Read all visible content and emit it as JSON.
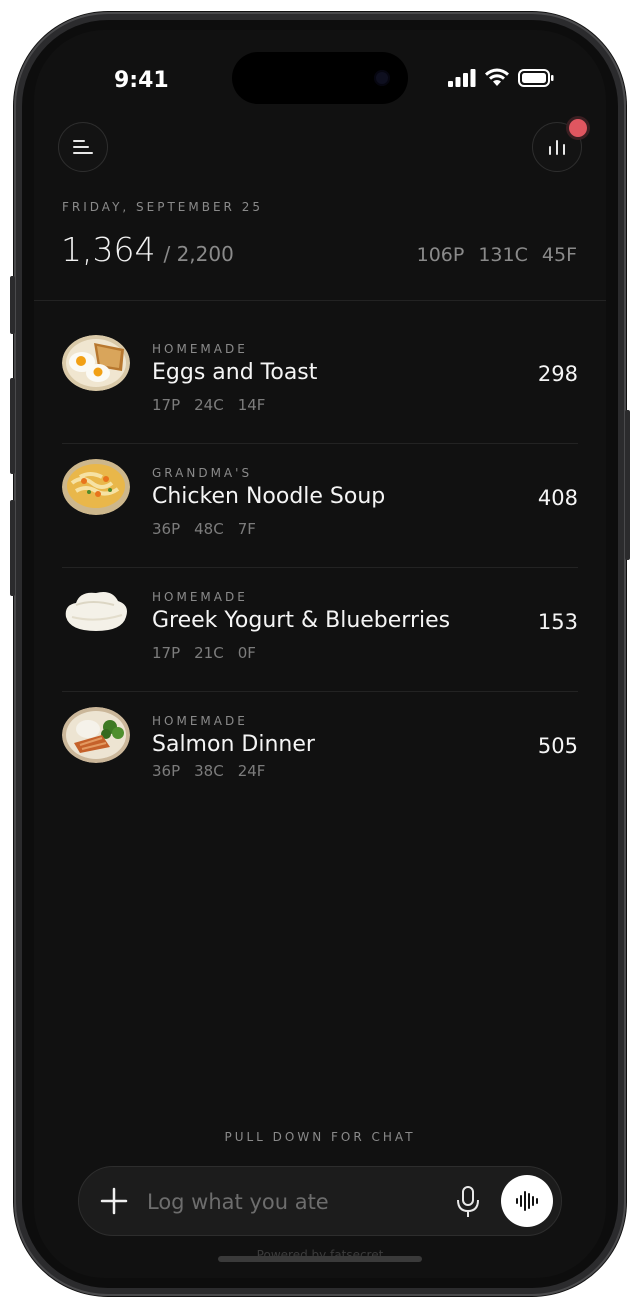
{
  "status_bar": {
    "time": "9:41"
  },
  "header": {
    "menu_icon": "menu-lines-icon",
    "stats_icon": "bar-chart-icon",
    "notification_color": "#e05660"
  },
  "summary": {
    "date": "FRIDAY, SEPTEMBER 25",
    "calories_consumed": "1,364",
    "calories_goal": "/ 2,200",
    "protein": "106P",
    "carbs": "131C",
    "fat": "45F"
  },
  "meals": [
    {
      "source": "HOMEMADE",
      "name": "Eggs and Toast",
      "calories": "298",
      "protein": "17P",
      "carbs": "24C",
      "fat": "14F",
      "image": "eggs-toast"
    },
    {
      "source": "GRANDMA'S",
      "name": "Chicken Noodle Soup",
      "calories": "408",
      "protein": "36P",
      "carbs": "48C",
      "fat": "7F",
      "image": "noodle-soup"
    },
    {
      "source": "HOMEMADE",
      "name": "Greek Yogurt & Blueberries",
      "calories": "153",
      "protein": "17P",
      "carbs": "21C",
      "fat": "0F",
      "image": "yogurt"
    },
    {
      "source": "HOMEMADE",
      "name": "Salmon Dinner",
      "calories": "505",
      "protein": "36P",
      "carbs": "38C",
      "fat": "24F",
      "image": "salmon"
    }
  ],
  "composer": {
    "hint": "PULL DOWN FOR CHAT",
    "placeholder": "Log what you ate",
    "add_icon": "plus-icon",
    "mic_icon": "microphone-icon",
    "voice_icon": "waveform-icon"
  },
  "footer": {
    "powered_by": "Powered by fatsecret"
  }
}
